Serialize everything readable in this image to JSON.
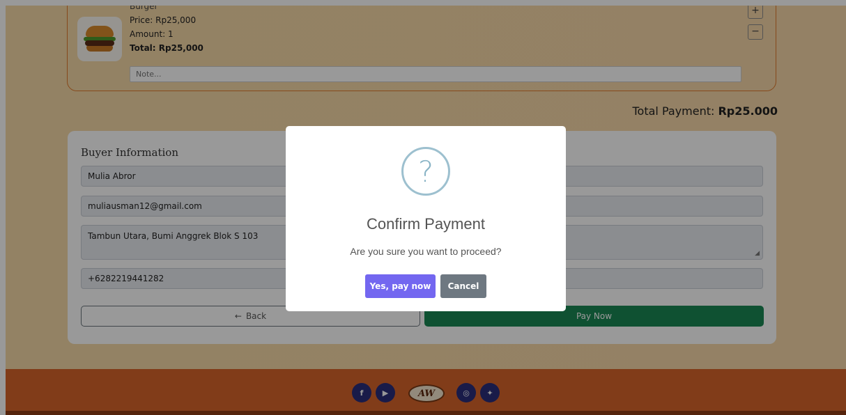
{
  "cart": {
    "item": {
      "name": "Burger",
      "price": "Price: Rp25,000",
      "amount": "Amount: 1",
      "total": "Total: Rp25,000",
      "note_placeholder": "Note..."
    },
    "plus_label": "+",
    "minus_label": "−"
  },
  "summary": {
    "total_label": "Total Payment:",
    "total_value": "Rp25.000"
  },
  "buyer": {
    "title": "Buyer Information",
    "name": "Mulia Abror",
    "email": "muliausman12@gmail.com",
    "address": "Tambun Utara, Bumi Anggrek Blok S 103",
    "phone": "+6282219441282",
    "back_label": "Back",
    "pay_label": "Pay Now"
  },
  "footer": {
    "logo_text": "AW",
    "icons": [
      "facebook-icon",
      "youtube-icon",
      "instagram-icon",
      "twitter-icon"
    ]
  },
  "modal": {
    "icon": "?",
    "title": "Confirm Payment",
    "text": "Are you sure you want to proceed?",
    "confirm_label": "Yes, pay now",
    "cancel_label": "Cancel"
  },
  "colors": {
    "accent": "#7367f0",
    "pay_green": "#198754",
    "footer": "#d8642a"
  }
}
